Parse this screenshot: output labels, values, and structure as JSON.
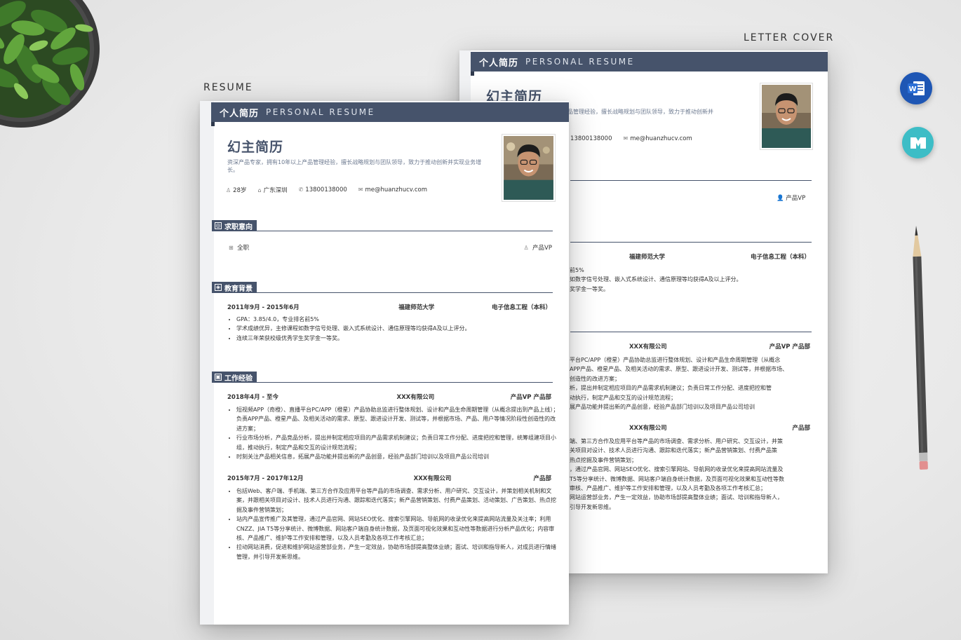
{
  "labels": {
    "resume": "RESUME",
    "letter_cover": "LETTER COVER"
  },
  "header": {
    "cn": "个人简历",
    "en": "PERSONAL RESUME"
  },
  "profile": {
    "name": "幻主简历",
    "summary": "资深产品专家，拥有10年以上产品管理经验，擅长战略规划与团队领导，致力于推动创新并实现业务增长。",
    "summary_back": "品管理经验，擅长战略规划与团队领导，致力于推动创新并",
    "age": "28岁",
    "city": "广东深圳",
    "phone": "13800138000",
    "email": "me@huanzhucv.com"
  },
  "sections": {
    "intent": "求职意向",
    "education": "教育背景",
    "work": "工作经验"
  },
  "intent": {
    "type": "全职",
    "position": "产品VP"
  },
  "education": {
    "period": "2011年9月 - 2015年6月",
    "school": "福建师范大学",
    "major": "电子信息工程（本科）",
    "bullets": [
      "GPA：3.85/4.0，专业排名前5%",
      "学术成绩优异，主修课程如数字信号处理、嵌入式系统设计、通信原理等均获得A及以上评分。",
      "连续三年荣获校级优秀学生奖学金一等奖。"
    ]
  },
  "work": [
    {
      "period": "2018年4月 - 至今",
      "company": "XXX有限公司",
      "role": "产品VP 产品部",
      "bullets": [
        "短视频APP（奇橙）、直播平台PC/APP（橙星）产品协助总监进行整体规划、设计和产品生命周期管理（从概念提出到产品上线）；负责APP产品、橙星产品、及相关活动的需求、原型、跟进设计开发、测试等，并根据市场、产品、用户等情况阶段性创造性的改进方案；",
        "行业市场分析，产品竞品分析，提出并制定相应项目的产品需求机制建议；负责日常工作分配、进度把控和管理，统筹组建项目小组，推动执行，制定产品和交互的设计规范流程；",
        "时刻关注产品相关信息，拓展产品功能并提出新的产品创意，经验产品部门培训以及项目产品公司培训"
      ]
    },
    {
      "period": "2015年7月 - 2017年12月",
      "company": "XXX有限公司",
      "role": "产品部",
      "bullets": [
        "包括Web、客户端、手机端、第三方合作及应用平台等产品的市场调查、需求分析、用户研究、交互设计，并策划相关机制和文案，并跟相关项目对设计、技术人员进行沟通、跟踪和迭代落实；新产品营销策划、付费产品策划、活动策划、广告策划、热点挖掘及事件营销策划；",
        "站内产品宣传推广及其管理，通过产品官网、网站SEO优化、搜索引擎网站、导航网的收录优化来提高网站流量及关注率；利用CNZZ、JIA T5等分享统计、微博数据、网站客户端自身统计数据，及页面可视化效果和互动性等数据进行分析产品优化；内容审核、产品推广、维护等工作安排和管理，以及人员考勤及各项工作考核汇总；",
        "拉动网站消费，促进和维护网站运营部业务，产生一定效益，协助市场部提高整体业绩；面试、培训和指导新人，对成员进行情绪管理，并引导开发新思维。"
      ]
    }
  ],
  "back": {
    "edu_line": [
      "福建师范大学",
      "电子信息工程（本科）"
    ],
    "edu_frags": [
      "前5%",
      "如数字信号处理、嵌入式系统设计、通信原理等均获得A及以上评分。",
      "奖学金一等奖。"
    ],
    "w1": [
      "XXX有限公司",
      "产品VP 产品部"
    ],
    "w1_frags": [
      "平台PC/APP（橙星）产品协助总监进行整体规划、设计和产品生命周期管理（从概念",
      "APP产品、橙星产品、及相关活动的需求、原型、跟进设计开发、测试等，并根据市场、",
      "创造性的改进方案；",
      "析，提出并制定相应项目的产品需求机制建议；负责日常工作分配、进度把控和管",
      "动执行，制定产品和交互的设计规范流程；",
      "展产品功能并提出新的产品创意，经验产品部门培训以及项目产品公司培训"
    ],
    "w2": [
      "XXX有限公司",
      "产品部"
    ],
    "w2_frags": [
      "端、第三方合作及应用平台等产品的市场调查、需求分析、用户研究、交互设计，并策",
      "关项目对设计、技术人员进行沟通、跟踪和迭代落实；新产品营销策划、付费产品策",
      "热点挖掘及事件营销策划；",
      "，通过产品官网、网站SEO优化、搜索引擎网站、导航网的收录优化来提高网站流量及",
      "T5等分享统计、微博数据、网站客户端自身统计数据，及页面可视化效果和互动性等数",
      "审核、产品推广、维护等工作安排和管理，以及人员考勤及各项工作考核汇总；",
      "网站运营部业务，产生一定效益，协助市场部提高整体业绩；面试、培训和指导新人，",
      "引导开发新思维。"
    ]
  },
  "icons": {
    "word": "word-app-icon",
    "note": "notes-app-icon"
  },
  "colors": {
    "accent": "#46536b",
    "word": "#1e56b4",
    "note": "#3dbdc6"
  }
}
